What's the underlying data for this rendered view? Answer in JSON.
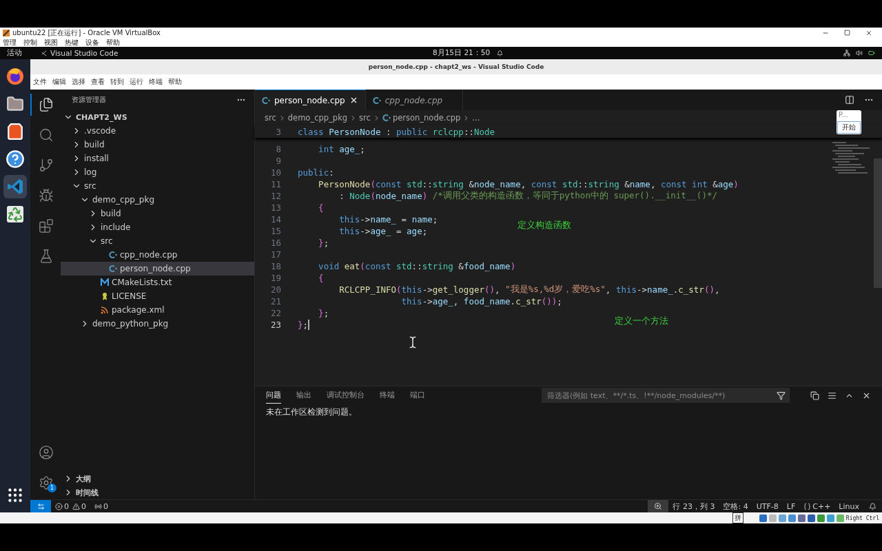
{
  "vbox": {
    "title": "ubuntu22 [正在运行] - Oracle VM VirtualBox",
    "menu": [
      "管理",
      "控制",
      "视图",
      "热键",
      "设备",
      "帮助"
    ],
    "status_key": "Right Ctrl"
  },
  "topbar": {
    "activities": "活动",
    "app": "Visual Studio Code",
    "clock": "8月15日 21：50"
  },
  "vscode": {
    "title": "person_node.cpp - chapt2_ws - Visual Studio Code",
    "menu": [
      "文件",
      "编辑",
      "选择",
      "查看",
      "转到",
      "运行",
      "终端",
      "帮助"
    ]
  },
  "activity_bar": [
    {
      "kind": "explorer",
      "selected": true
    },
    {
      "kind": "search",
      "selected": false
    },
    {
      "kind": "scm",
      "selected": false
    },
    {
      "kind": "debug",
      "selected": false
    },
    {
      "kind": "extensions",
      "selected": false
    },
    {
      "kind": "testing",
      "selected": false
    }
  ],
  "settings_badge": "1",
  "explorer": {
    "title": "资源管理器",
    "workspace": {
      "label": "CHAPT2_WS",
      "expanded": true
    },
    "tree": [
      {
        "label": ".vscode",
        "kind": "folder",
        "expanded": false,
        "selected": false
      },
      {
        "label": "build",
        "kind": "folder",
        "expanded": false,
        "selected": false
      },
      {
        "label": "install",
        "kind": "folder",
        "expanded": false,
        "selected": false
      },
      {
        "label": "log",
        "kind": "folder",
        "expanded": false,
        "selected": false
      },
      {
        "label": "src",
        "kind": "folder",
        "expanded": true,
        "selected": false,
        "children": [
          {
            "label": "demo_cpp_pkg",
            "kind": "folder",
            "expanded": true,
            "selected": false,
            "children": [
              {
                "label": "build",
                "kind": "folder",
                "expanded": false,
                "selected": false
              },
              {
                "label": "include",
                "kind": "folder",
                "expanded": false,
                "selected": false
              },
              {
                "label": "src",
                "kind": "folder",
                "expanded": true,
                "selected": false,
                "children": [
                  {
                    "label": "cpp_node.cpp",
                    "kind": "cpp",
                    "selected": false
                  },
                  {
                    "label": "person_node.cpp",
                    "kind": "cpp",
                    "selected": true
                  }
                ]
              },
              {
                "label": "CMakeLists.txt",
                "kind": "cmake",
                "selected": false
              },
              {
                "label": "LICENSE",
                "kind": "license",
                "selected": false
              },
              {
                "label": "package.xml",
                "kind": "xml",
                "selected": false
              }
            ]
          },
          {
            "label": "demo_python_pkg",
            "kind": "folder",
            "expanded": false,
            "selected": false
          }
        ]
      }
    ],
    "sections": [
      {
        "label": "大纲",
        "expanded": false
      },
      {
        "label": "时间线",
        "expanded": false
      }
    ]
  },
  "tabs": [
    {
      "label": "person_node.cpp",
      "selected": true,
      "preview": false
    },
    {
      "label": "cpp_node.cpp",
      "selected": false,
      "preview": true
    }
  ],
  "breadcrumb": [
    {
      "label": "src",
      "kind": "folder"
    },
    {
      "label": "demo_cpp_pkg",
      "kind": "folder"
    },
    {
      "label": "src",
      "kind": "folder"
    },
    {
      "label": "person_node.cpp",
      "kind": "cpp"
    },
    {
      "label": "…",
      "kind": "symbol"
    }
  ],
  "sticky": {
    "no": "3",
    "text": "class PersonNode : public rclcpp::Node"
  },
  "lines": [
    {
      "no": "8",
      "cursor": false,
      "text": "    int age_;"
    },
    {
      "no": "9",
      "cursor": false
    },
    {
      "no": "10",
      "cursor": false,
      "text": "public:"
    },
    {
      "no": "11",
      "cursor": false,
      "text": "    PersonNode(const std::string &node_name, const std::string &name, const int &age)"
    },
    {
      "no": "12",
      "cursor": false,
      "text": "        : Node(node_name) /*调用父类的构造函数，等同于python中的 super().__init__()*/"
    },
    {
      "no": "13",
      "cursor": false,
      "text": "    {"
    },
    {
      "no": "14",
      "cursor": false,
      "text": "        this->name_ = name;"
    },
    {
      "no": "15",
      "cursor": false,
      "text": "        this->age_ = age;"
    },
    {
      "no": "16",
      "cursor": false,
      "text": "    };"
    },
    {
      "no": "17",
      "cursor": false
    },
    {
      "no": "18",
      "cursor": false,
      "text": "    void eat(const std::string &food_name)"
    },
    {
      "no": "19",
      "cursor": false,
      "text": "    {"
    },
    {
      "no": "20",
      "cursor": false,
      "text": "        RCLCPP_INFO(this->get_logger(), \"我是%s,%d岁，爱吃%s\", this->name_.c_str(),"
    },
    {
      "no": "21",
      "cursor": false,
      "text": "                    this->age_, food_name.c_str());"
    },
    {
      "no": "22",
      "cursor": false,
      "text": "    };"
    },
    {
      "no": "23",
      "cursor": true,
      "text": "};"
    }
  ],
  "annotations": [
    {
      "text": "定义构造函数"
    },
    {
      "text": "定义一个方法"
    }
  ],
  "ime_popup": {
    "preedit": "P...",
    "action": "开始"
  },
  "ime_status": "拼",
  "panel": {
    "tabs": [
      {
        "label": "问题",
        "selected": true
      },
      {
        "label": "输出",
        "selected": false
      },
      {
        "label": "调试控制台",
        "selected": false
      },
      {
        "label": "终端",
        "selected": false
      },
      {
        "label": "端口",
        "selected": false
      }
    ],
    "filter_placeholder": "筛选器(例如 text、**/*.ts、!**/node_modules/**)",
    "message": "未在工作区检测到问题。"
  },
  "status_bar": {
    "errors": "0",
    "warnings": "0",
    "ports": "0",
    "right": [
      {
        "kind": "text",
        "label": "行 23，列 3"
      },
      {
        "kind": "text",
        "label": "空格: 4"
      },
      {
        "kind": "text",
        "label": "UTF-8"
      },
      {
        "kind": "text",
        "label": "LF"
      },
      {
        "kind": "language",
        "label": "C++"
      },
      {
        "kind": "text",
        "label": "Linux"
      }
    ]
  }
}
